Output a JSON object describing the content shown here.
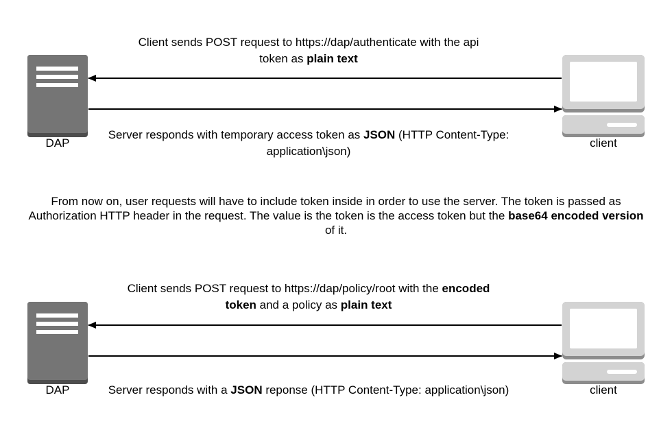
{
  "colors": {
    "server_body": "#757575",
    "server_shadow": "#4d4d4d",
    "server_lines": "#ffffff",
    "client_frame": "#d3d3d3",
    "client_shadow": "#8c8c8c",
    "arrow": "#000000",
    "text": "#000000"
  },
  "icons": {
    "server": "server-icon",
    "client": "desktop-computer-icon"
  },
  "exchange1": {
    "server_label": "DAP",
    "client_label": "client",
    "request": {
      "part1": "Client sends POST request to https://dap/authenticate with the api",
      "part2": "token as ",
      "part3": "plain text"
    },
    "response": {
      "part1": "Server responds with temporary access token as ",
      "part2": "JSON",
      "part3": " (HTTP Content-Type:",
      "part4": "application\\json)"
    }
  },
  "note": {
    "part1": "From now on, user requests  will have to include token inside in order to use the server. The token is passed as Authorization HTTP header in the request. The value is the token is the access token but the ",
    "part2": "base64 encoded version",
    "part3": " of it."
  },
  "exchange2": {
    "server_label": "DAP",
    "client_label": "client",
    "request": {
      "part1": "Client sends POST request to https://dap/policy/root with the ",
      "part2": "encoded",
      "part3": "token",
      "part4": " and a policy as ",
      "part5": "plain text"
    },
    "response": {
      "part1": "Server responds with a ",
      "part2": "JSON",
      "part3": " reponse (HTTP Content-Type: application\\json)"
    }
  }
}
